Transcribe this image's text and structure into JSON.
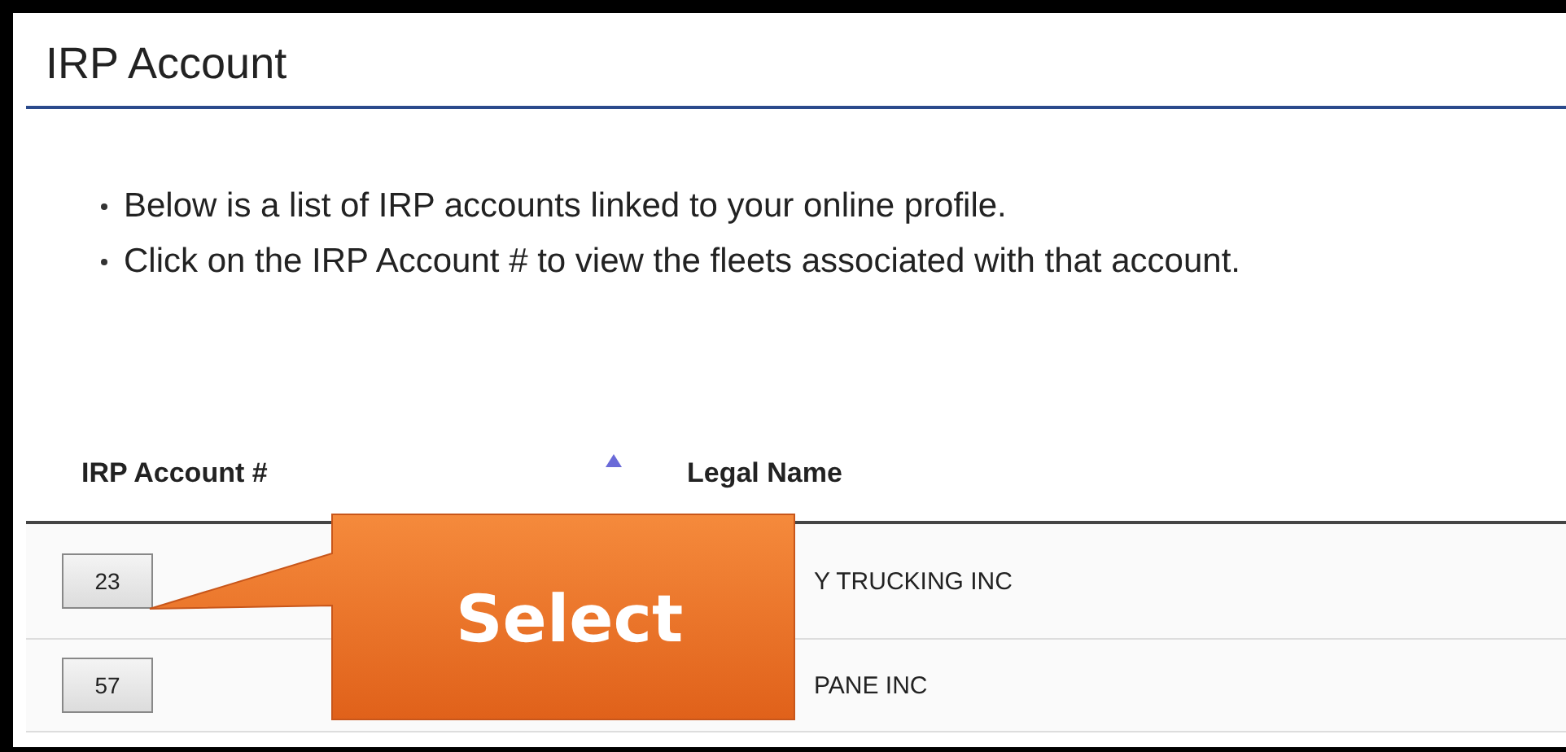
{
  "title": "IRP Account",
  "instructions": [
    "Below is a list of IRP accounts linked to your online profile.",
    "Click on the IRP Account # to view the fleets associated with that account."
  ],
  "table": {
    "columns": [
      {
        "label": "IRP Account #",
        "sorted": true
      },
      {
        "label": "Legal Name",
        "sorted": false
      }
    ],
    "rows": [
      {
        "account": "23",
        "legal_name": "Y TRUCKING INC"
      },
      {
        "account": "57",
        "legal_name": "PANE INC"
      }
    ]
  },
  "callout": {
    "label": "Select"
  }
}
